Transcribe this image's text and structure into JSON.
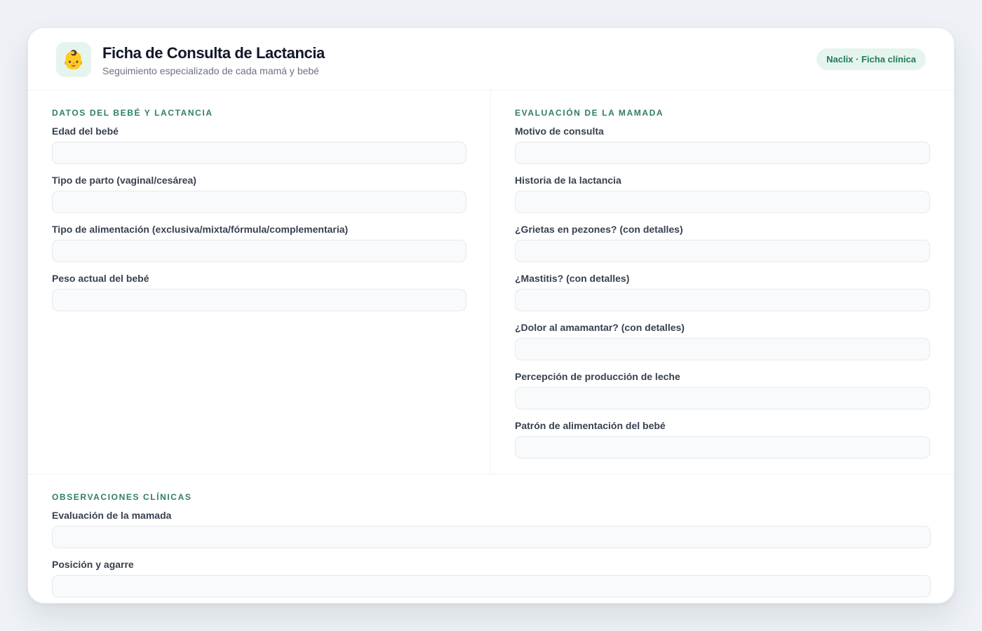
{
  "header": {
    "logo_icon": "baby-face-icon",
    "logo_glyph": "👶",
    "title": "Ficha de Consulta de Lactancia",
    "subtitle": "Seguimiento especializado de cada mamá y bebé",
    "badge": "Naclix · Ficha clínica"
  },
  "colors": {
    "accent": "#2f7d67",
    "badge_bg": "#e6f4ee",
    "page_bg": "#eef2f6"
  },
  "left_section": {
    "title": "Datos del bebé y lactancia",
    "fields": [
      {
        "label": "Edad del bebé",
        "value": "",
        "placeholder": ""
      },
      {
        "label": "Tipo de parto (vaginal/cesárea)",
        "value": "",
        "placeholder": ""
      },
      {
        "label": "Tipo de alimentación (exclusiva/mixta/fórmula/complementaria)",
        "value": "",
        "placeholder": ""
      },
      {
        "label": "Peso actual del bebé",
        "value": "",
        "placeholder": ""
      }
    ]
  },
  "right_section": {
    "title": "Evaluación de la mamada",
    "fields": [
      {
        "label": "Motivo de consulta",
        "value": "",
        "placeholder": ""
      },
      {
        "label": "Historia de la lactancia",
        "value": "",
        "placeholder": ""
      },
      {
        "label": "¿Grietas en pezones? (con detalles)",
        "value": "",
        "placeholder": ""
      },
      {
        "label": "¿Mastitis? (con detalles)",
        "value": "",
        "placeholder": ""
      },
      {
        "label": "¿Dolor al amamantar? (con detalles)",
        "value": "",
        "placeholder": ""
      },
      {
        "label": "Percepción de producción de leche",
        "value": "",
        "placeholder": ""
      },
      {
        "label": "Patrón de alimentación del bebé",
        "value": "",
        "placeholder": ""
      }
    ]
  },
  "bottom_section": {
    "title": "Observaciones clínicas",
    "fields": [
      {
        "label": "Evaluación de la mamada",
        "value": "",
        "placeholder": ""
      },
      {
        "label": "Posición y agarre",
        "value": "",
        "placeholder": ""
      }
    ]
  }
}
